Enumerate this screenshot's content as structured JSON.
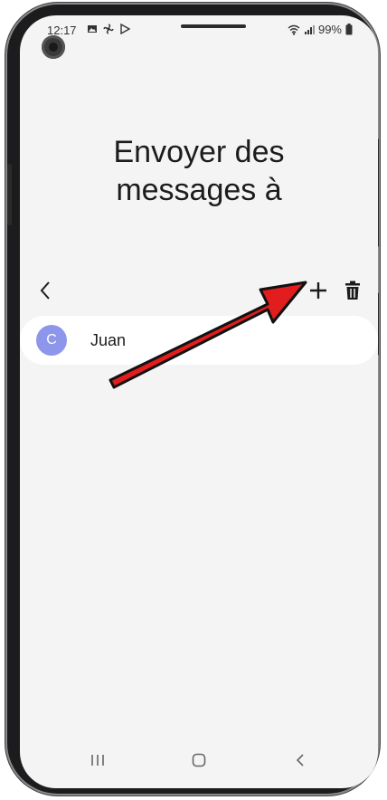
{
  "status_bar": {
    "time": "12:17",
    "battery": "99%",
    "icons": [
      "image-icon",
      "pinwheel-icon",
      "play-store-icon",
      "wifi-icon",
      "signal-icon",
      "battery-icon"
    ]
  },
  "page": {
    "title_line1": "Envoyer des",
    "title_line2": "messages à"
  },
  "toolbar": {
    "back_icon": "chevron-left-icon",
    "add_icon": "plus-icon",
    "delete_icon": "trash-icon"
  },
  "contacts": [
    {
      "initial": "C",
      "name": "Juan",
      "avatar_color": "#8d96eb"
    }
  ],
  "navbar": {
    "icons": [
      "recents-icon",
      "home-icon",
      "back-icon"
    ]
  },
  "annotation": {
    "arrow_color": "#e11d1d"
  }
}
